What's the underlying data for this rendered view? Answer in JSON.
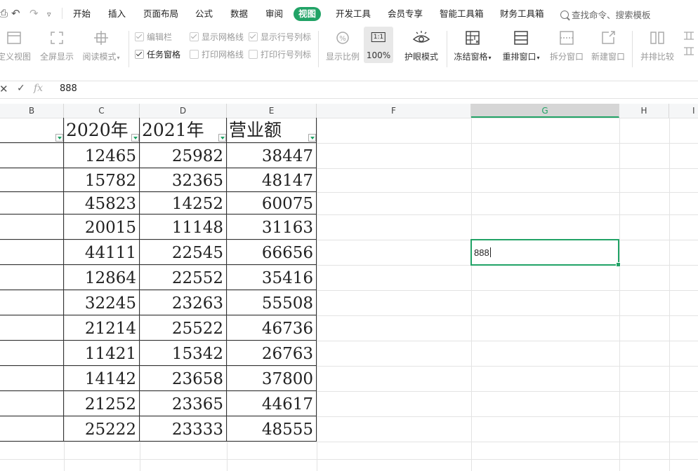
{
  "menu": {
    "quick_access": [
      "undo-icon",
      "redo-icon",
      "customize-icon"
    ],
    "tabs": [
      "开始",
      "插入",
      "页面布局",
      "公式",
      "数据",
      "审阅",
      "视图",
      "开发工具",
      "会员专享",
      "智能工具箱",
      "财务工具箱"
    ],
    "active_tab": "视图",
    "search_text": "查找命令、搜索模板"
  },
  "toolbar": {
    "custom_view": "定义视图",
    "full_screen": "全屏显示",
    "reading_mode": "阅读模式",
    "edit_bar": "编辑栏",
    "task_pane": "任务窗格",
    "show_gridlines": "显示网格线",
    "print_gridlines": "打印网格线",
    "show_row_col_headers": "显示行号列标",
    "print_row_col_headers": "打印行号列标",
    "zoom_ratio": "显示比例",
    "zoom_100": "100%",
    "zoom_100_icon": "1:1",
    "eye_mode": "护眼模式",
    "freeze_panes": "冻结窗格",
    "arrange_windows": "重排窗口",
    "split_window": "拆分窗口",
    "new_window": "新建窗口",
    "compare_side": "并排比较"
  },
  "formula_bar": {
    "fx": "fx",
    "value": "888"
  },
  "columns": [
    "B",
    "C",
    "D",
    "E",
    "F",
    "G",
    "H",
    "I"
  ],
  "selected_column": "G",
  "table": {
    "headers": [
      "2020年",
      "2021年",
      "营业额"
    ],
    "rows": [
      [
        "12465",
        "25982",
        "38447"
      ],
      [
        "15782",
        "32365",
        "48147"
      ],
      [
        "45823",
        "14252",
        "60075"
      ],
      [
        "20015",
        "11148",
        "31163"
      ],
      [
        "44111",
        "22545",
        "66656"
      ],
      [
        "12864",
        "22552",
        "35416"
      ],
      [
        "32245",
        "23263",
        "55508"
      ],
      [
        "21214",
        "25522",
        "46736"
      ],
      [
        "11421",
        "15342",
        "26763"
      ],
      [
        "14142",
        "23658",
        "37800"
      ],
      [
        "21252",
        "23365",
        "44617"
      ],
      [
        "25222",
        "23333",
        "48555"
      ]
    ]
  },
  "active_cell": {
    "value": "888"
  },
  "colors": {
    "accent": "#21a366",
    "grid": "#e3e3e3",
    "header_bg": "#f5f6f7"
  }
}
